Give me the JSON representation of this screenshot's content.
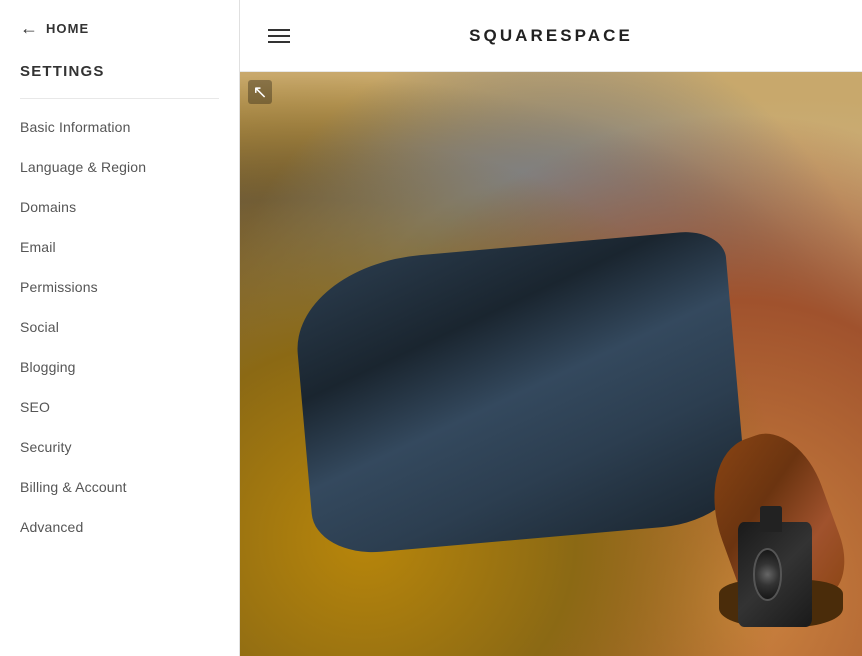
{
  "sidebar": {
    "back_label": "HOME",
    "settings_title": "SETTINGS",
    "nav_items": [
      {
        "id": "basic-information",
        "label": "Basic Information"
      },
      {
        "id": "language-region",
        "label": "Language & Region"
      },
      {
        "id": "domains",
        "label": "Domains"
      },
      {
        "id": "email",
        "label": "Email"
      },
      {
        "id": "permissions",
        "label": "Permissions"
      },
      {
        "id": "social",
        "label": "Social"
      },
      {
        "id": "blogging",
        "label": "Blogging"
      },
      {
        "id": "seo",
        "label": "SEO"
      },
      {
        "id": "security",
        "label": "Security"
      },
      {
        "id": "billing-account",
        "label": "Billing & Account"
      },
      {
        "id": "advanced",
        "label": "Advanced"
      }
    ]
  },
  "topbar": {
    "logo": "SQUARESPACE",
    "menu_icon_label": "menu"
  },
  "hero": {
    "pin_icon": "↖"
  }
}
